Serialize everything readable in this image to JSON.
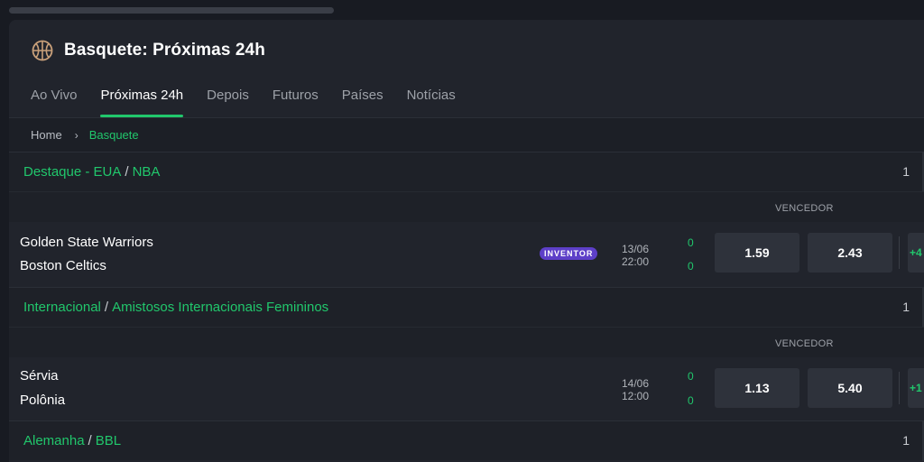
{
  "header": {
    "title": "Basquete: Próximas 24h",
    "tabs": [
      {
        "label": "Ao Vivo"
      },
      {
        "label": "Próximas 24h"
      },
      {
        "label": "Depois"
      },
      {
        "label": "Futuros"
      },
      {
        "label": "Países"
      },
      {
        "label": "Notícias"
      }
    ],
    "active_tab": "Próximas 24h"
  },
  "breadcrumb": {
    "home": "Home",
    "separator": "›",
    "current": "Basquete"
  },
  "leagues": [
    {
      "region": "Destaque - EUA",
      "name": "NBA",
      "count": "1",
      "market_label": "VENCEDOR",
      "events": [
        {
          "home": "Golden State Warriors",
          "away": "Boston Celtics",
          "badge": "INVENTOR",
          "date": "13/06",
          "time": "22:00",
          "score_home": "0",
          "score_away": "0",
          "odd_1": "1.59",
          "odd_2": "2.43",
          "more": "+4"
        }
      ]
    },
    {
      "region": "Internacional",
      "name": "Amistosos Internacionais Femininos",
      "count": "1",
      "market_label": "VENCEDOR",
      "events": [
        {
          "home": "Sérvia",
          "away": "Polônia",
          "date": "14/06",
          "time": "12:00",
          "score_home": "0",
          "score_away": "0",
          "odd_1": "1.13",
          "odd_2": "5.40",
          "more": "+1"
        }
      ]
    },
    {
      "region": "Alemanha",
      "name": "BBL",
      "count": "1"
    }
  ],
  "colors": {
    "accent": "#21c76c",
    "badge": "#5d3fc8",
    "background": "#21242c"
  }
}
